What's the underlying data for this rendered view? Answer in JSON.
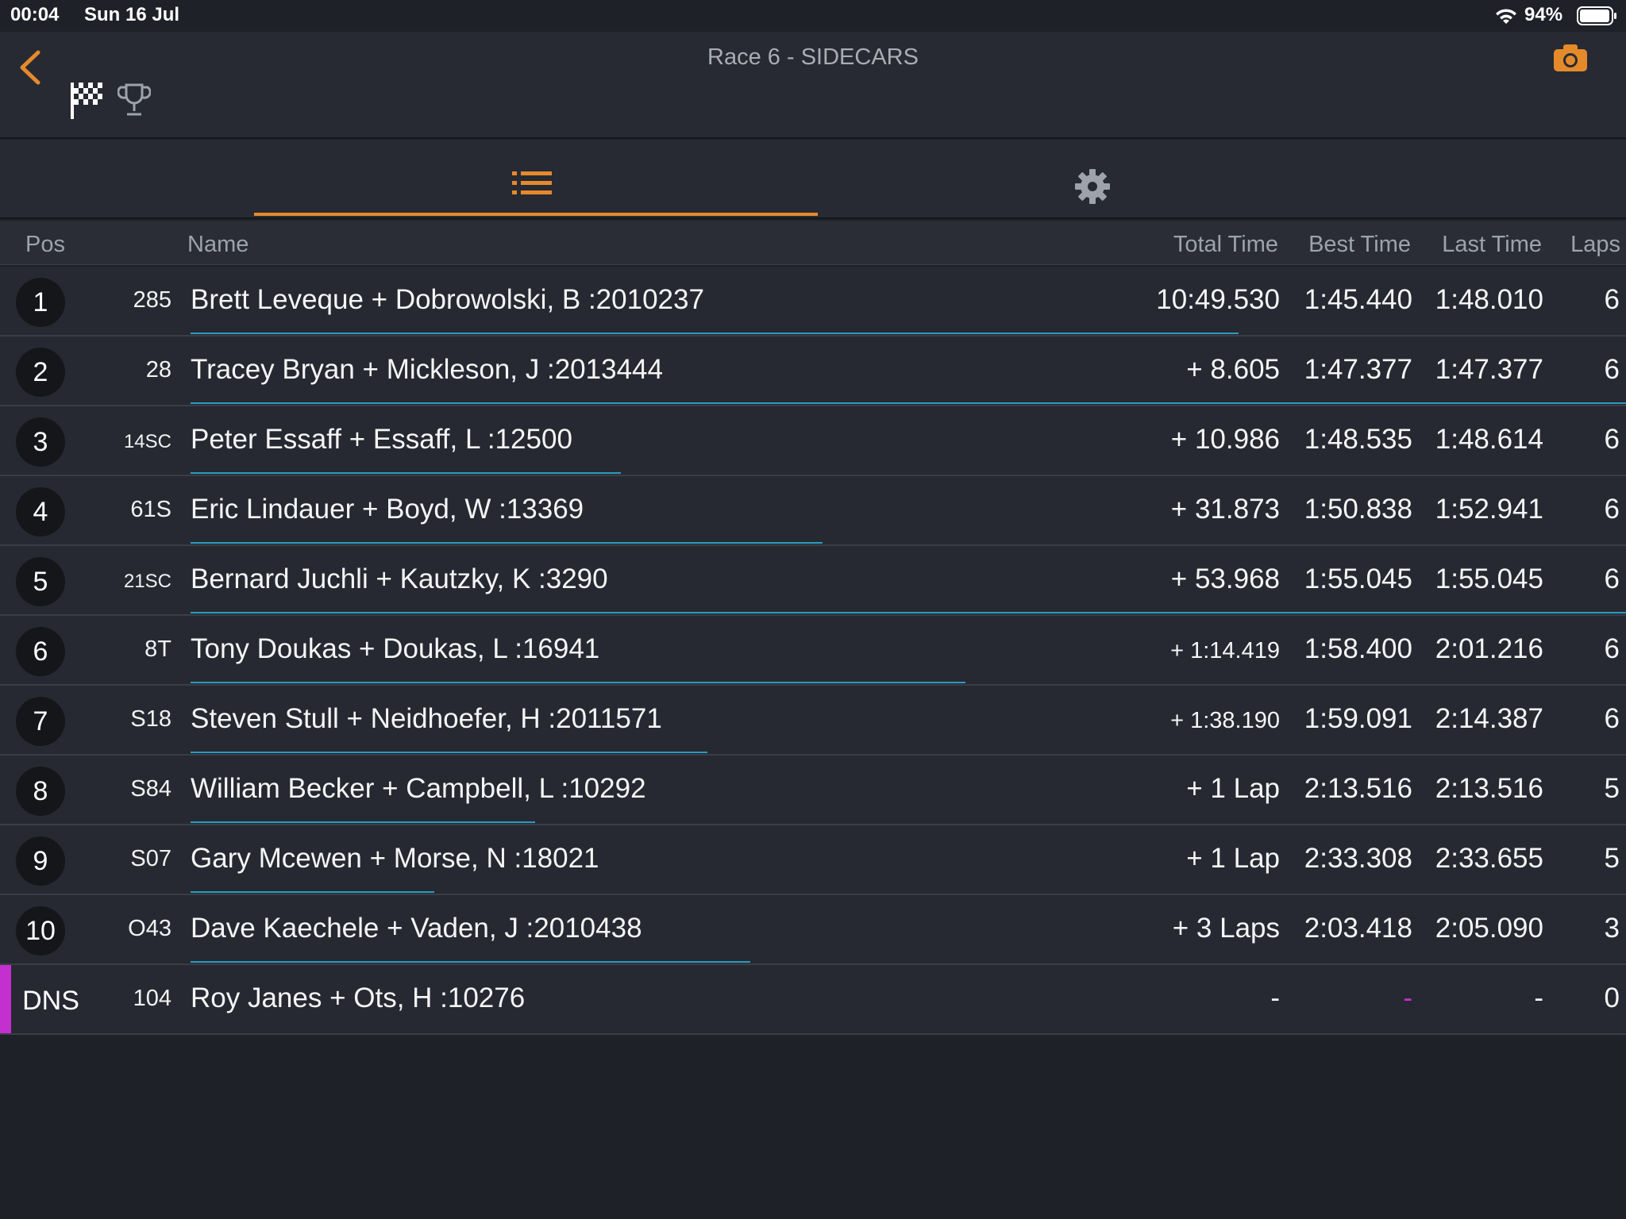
{
  "status_bar": {
    "time": "00:04",
    "date": "Sun 16 Jul",
    "battery": "94%"
  },
  "nav": {
    "title": "Race 6 - SIDECARS"
  },
  "columns": {
    "pos": "Pos",
    "name": "Name",
    "total_time": "Total Time",
    "best_time": "Best Time",
    "last_time": "Last Time",
    "laps": "Laps"
  },
  "rows": [
    {
      "pos": "1",
      "number": "285",
      "name": "Brett Leveque + Dobrowolski, B :2010237",
      "total": "10:49.530",
      "best": "1:45.440",
      "last": "1:48.010",
      "laps": "6",
      "progress": 0.73
    },
    {
      "pos": "2",
      "number": "28",
      "name": "Tracey Bryan + Mickleson, J :2013444",
      "total": "+ 8.605",
      "best": "1:47.377",
      "last": "1:47.377",
      "laps": "6",
      "progress": 1.0
    },
    {
      "pos": "3",
      "number": "14SC",
      "name": "Peter Essaff + Essaff, L :12500",
      "total": "+ 10.986",
      "best": "1:48.535",
      "last": "1:48.614",
      "laps": "6",
      "progress": 0.3
    },
    {
      "pos": "4",
      "number": "61S",
      "name": "Eric Lindauer + Boyd, W :13369",
      "total": "+ 31.873",
      "best": "1:50.838",
      "last": "1:52.941",
      "laps": "6",
      "progress": 0.44
    },
    {
      "pos": "5",
      "number": "21SC",
      "name": "Bernard Juchli + Kautzky, K :3290",
      "total": "+ 53.968",
      "best": "1:55.045",
      "last": "1:55.045",
      "laps": "6",
      "progress": 1.0
    },
    {
      "pos": "6",
      "number": "8T",
      "name": "Tony Doukas + Doukas, L :16941",
      "total": "+ 1:14.419",
      "best": "1:58.400",
      "last": "2:01.216",
      "laps": "6",
      "progress": 0.54
    },
    {
      "pos": "7",
      "number": "S18",
      "name": "Steven Stull + Neidhoefer, H :2011571",
      "total": "+ 1:38.190",
      "best": "1:59.091",
      "last": "2:14.387",
      "laps": "6",
      "progress": 0.36
    },
    {
      "pos": "8",
      "number": "S84",
      "name": "William Becker + Campbell, L :10292",
      "total": "+ 1 Lap",
      "best": "2:13.516",
      "last": "2:13.516",
      "laps": "5",
      "progress": 0.24
    },
    {
      "pos": "9",
      "number": "S07",
      "name": "Gary Mcewen + Morse, N :18021",
      "total": "+ 1 Lap",
      "best": "2:33.308",
      "last": "2:33.655",
      "laps": "5",
      "progress": 0.17
    },
    {
      "pos": "10",
      "number": "O43",
      "name": "Dave Kaechele + Vaden, J :2010438",
      "total": "+ 3 Laps",
      "best": "2:03.418",
      "last": "2:05.090",
      "laps": "3",
      "progress": 0.39
    },
    {
      "pos": "DNS",
      "number": "104",
      "name": "Roy Janes + Ots, H :10276",
      "total": "-",
      "best": "-",
      "last": "-",
      "laps": "0",
      "progress": 0
    }
  ],
  "colors": {
    "accent": "#e58a2b",
    "progress": "#2a9cc0",
    "dns": "#c42fd0"
  },
  "icons": {
    "back": "chevron-left-icon",
    "flag": "checkered-flag-icon",
    "trophy": "trophy-icon",
    "camera": "camera-icon",
    "list": "list-icon",
    "settings": "gear-icon"
  }
}
